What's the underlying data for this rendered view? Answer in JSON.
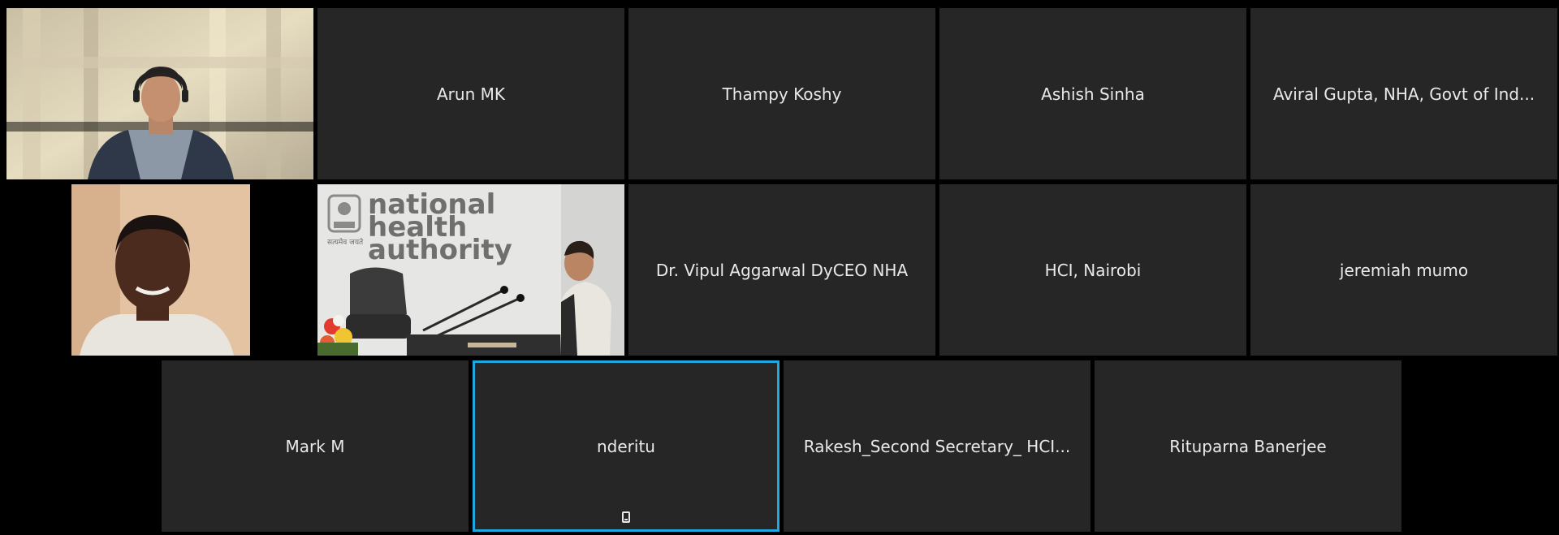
{
  "meeting": {
    "participants_row1": [
      "Arun MK",
      "Thampy Koshy",
      "Ashish Sinha",
      "Aviral Gupta, NHA, Govt of Ind..."
    ],
    "participants_row2": [
      "Dr. Vipul Aggarwal DyCEO NHA",
      "HCI, Nairobi",
      "jeremiah mumo"
    ],
    "participants_row3": [
      "Mark M",
      "nderitu",
      "Rakesh_Second Secretary_ HCI...",
      "Rituparna Banerjee"
    ],
    "active_speaker": "nderitu",
    "active_device_icon": "mobile-phone-icon",
    "nha_logo": {
      "line1": "national",
      "line2": "health",
      "line3": "authority",
      "emblem_motto": "सत्यमेव जयते"
    }
  },
  "colors": {
    "background": "#000000",
    "tile": "#262626",
    "active_border": "#1fa8e0",
    "name_text": "#e9e9e9"
  }
}
